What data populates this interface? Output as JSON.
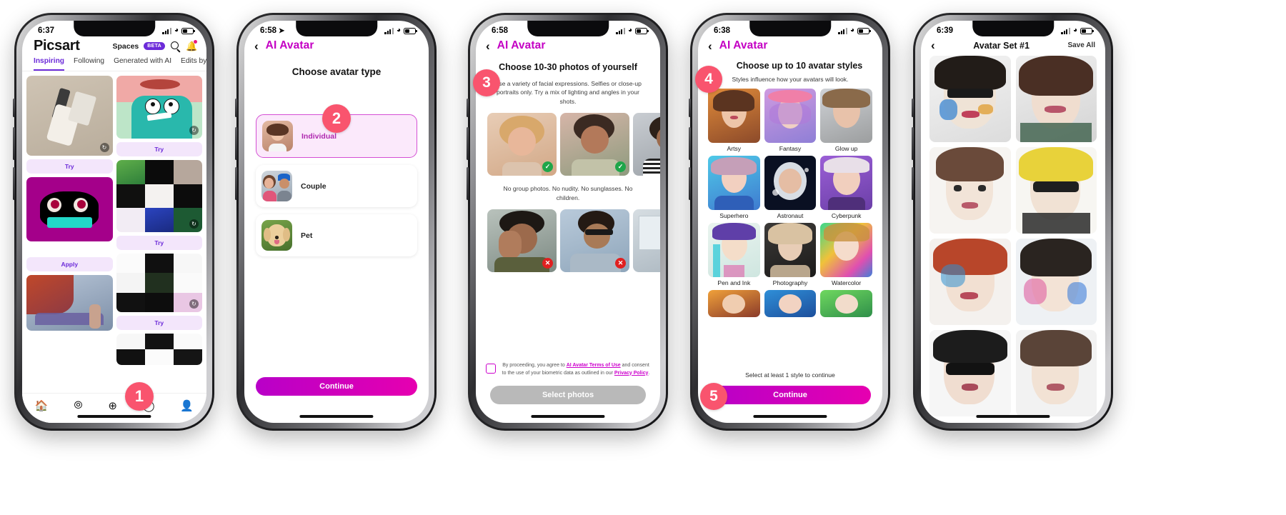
{
  "meta": {
    "brand_purple": "#6c2bd9",
    "brand_magenta": "#cc00cc",
    "step_badge_color": "#f9546e",
    "screens": 5
  },
  "phone1": {
    "status": {
      "time": "6:37",
      "signal_icon": "cellular-bars-icon",
      "wifi_icon": "wifi-icon",
      "battery_icon": "battery-icon"
    },
    "header": {
      "logo": "Picsart",
      "spaces_label": "Spaces",
      "beta_badge": "BETA",
      "search_icon": "search-icon",
      "bell_icon": "bell-icon"
    },
    "tabs": [
      {
        "label": "Inspiring",
        "active": true
      },
      {
        "label": "Following",
        "active": false
      },
      {
        "label": "Generated with AI",
        "active": false
      },
      {
        "label": "Edits by M",
        "active": false
      }
    ],
    "feed": {
      "left": [
        {
          "type": "photo",
          "cta": "Try",
          "replay_icon": "replay-icon"
        },
        {
          "type": "photo",
          "cta": "Apply"
        },
        {
          "type": "photo",
          "cta": ""
        }
      ],
      "right": [
        {
          "type": "photo",
          "cta": "Try",
          "replay_icon": "replay-icon"
        },
        {
          "type": "mosaic",
          "cta": "Try",
          "replay_icon": "replay-icon"
        },
        {
          "type": "mosaic",
          "cta": "Try"
        },
        {
          "type": "mosaic",
          "cta": ""
        }
      ]
    },
    "tabbar": [
      {
        "icon": "home-icon",
        "label": ""
      },
      {
        "icon": "compass-icon",
        "label": ""
      },
      {
        "icon": "plus-circle-icon",
        "label": ""
      },
      {
        "icon": "messages-icon",
        "label": ""
      },
      {
        "icon": "profile-icon",
        "label": ""
      }
    ],
    "step_badge": "1"
  },
  "phone2": {
    "status": {
      "time": "6:58",
      "location_icon": "location-arrow-icon"
    },
    "nav": {
      "back_icon": "chevron-left-icon",
      "title": "AI Avatar"
    },
    "heading": "Choose avatar type",
    "step_badge": "2",
    "options": [
      {
        "label": "Individual",
        "selected": true,
        "thumb": "woman-portrait"
      },
      {
        "label": "Couple",
        "selected": false,
        "thumb": "couple-portrait"
      },
      {
        "label": "Pet",
        "selected": false,
        "thumb": "golden-retriever"
      }
    ],
    "primary_button": "Continue"
  },
  "phone3": {
    "status": {
      "time": "6:58"
    },
    "nav": {
      "back_icon": "chevron-left-icon",
      "title": "AI Avatar"
    },
    "heading": "Choose 10-30 photos of yourself",
    "step_badge": "3",
    "good_hint": "Use a variety of facial expressions. Selfies or close-up portraits only. Try a mix of lighting and angles in your shots.",
    "bad_hint": "No group photos. No nudity. No sunglasses. No children.",
    "good_photos": [
      {
        "mark": "ok",
        "mark_icon": "check-icon"
      },
      {
        "mark": "ok",
        "mark_icon": "check-icon"
      },
      {
        "mark": "ok",
        "mark_icon": "check-icon"
      }
    ],
    "bad_photos": [
      {
        "mark": "no",
        "mark_icon": "cross-icon"
      },
      {
        "mark": "no",
        "mark_icon": "cross-icon"
      },
      {
        "mark": "no",
        "mark_icon": "cross-icon"
      }
    ],
    "consent": {
      "checkbox": "consent-checkbox",
      "text_before": "By proceeding, you agree to ",
      "link1": "AI Avatar Terms of Use",
      "text_middle": " and consent to the use of your biometric data as outlined in our ",
      "link2": "Privacy Policy",
      "text_after": "."
    },
    "primary_button": "Select photos",
    "primary_disabled": true
  },
  "phone4": {
    "status": {
      "time": "6:38"
    },
    "nav": {
      "back_icon": "chevron-left-icon",
      "title": "AI Avatar"
    },
    "heading": "Choose up to 10 avatar styles",
    "subheading": "Styles influence how your avatars will look.",
    "step_badge": "4",
    "styles": [
      {
        "label": "Artsy"
      },
      {
        "label": "Fantasy"
      },
      {
        "label": "Glow up"
      },
      {
        "label": "Superhero"
      },
      {
        "label": "Astronaut"
      },
      {
        "label": "Cyberpunk"
      },
      {
        "label": "Pen and Ink"
      },
      {
        "label": "Photography"
      },
      {
        "label": "Watercolor"
      },
      {
        "label": ""
      },
      {
        "label": ""
      },
      {
        "label": ""
      }
    ],
    "hint": "Select at least 1 style to continue",
    "primary_button": "Continue",
    "step_badge_bottom": "5"
  },
  "phone5": {
    "status": {
      "time": "6:39"
    },
    "nav": {
      "back_icon": "chevron-left-icon",
      "title": "Avatar Set #1",
      "save_all": "Save All"
    },
    "avatars": [
      {
        "id": "avatar-1"
      },
      {
        "id": "avatar-2"
      },
      {
        "id": "avatar-3"
      },
      {
        "id": "avatar-4"
      },
      {
        "id": "avatar-5"
      },
      {
        "id": "avatar-6"
      },
      {
        "id": "avatar-7"
      },
      {
        "id": "avatar-8"
      }
    ]
  }
}
